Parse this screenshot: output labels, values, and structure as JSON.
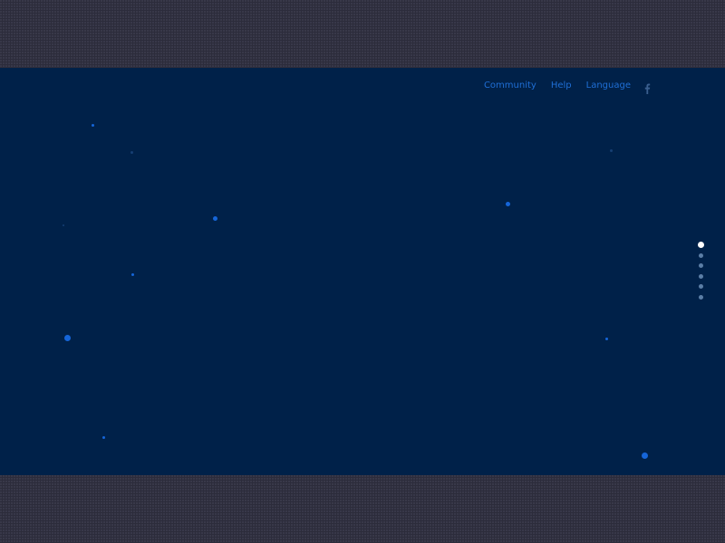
{
  "nav": {
    "community_label": "Community",
    "help_label": "Help",
    "language_label": "Language",
    "social_icon": "facebook-icon"
  },
  "pager": {
    "total": 6,
    "active_index": 0
  },
  "colors": {
    "stage_background": "#002149",
    "band_background": "#2c2c3b",
    "nav_link": "#1f6fd6",
    "star": "#1565d8",
    "pager_active": "#ffffff",
    "pager_inactive": "#5b7ea6"
  }
}
